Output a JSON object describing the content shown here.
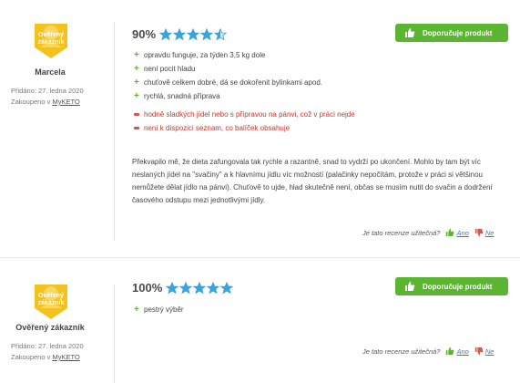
{
  "colors": {
    "green": "#5cb531",
    "red": "#d9534f",
    "star_blue": "#3aa3d8",
    "badge_gold": "#f4c21f"
  },
  "reviews": [
    {
      "badge_text": "Ověřený zákazník",
      "name": "Marcela",
      "date": "Přidáno: 27. ledna 2020",
      "bought_prefix": "Zakoupeno v",
      "bought_shop": "MyKETO",
      "rating_percent": "90%",
      "stars_filled": 4.5,
      "recommend_label": "Doporučuje produkt",
      "pros": [
        "opravdu funguje, za týden 3,5 kg dole",
        "není pocit hladu",
        "chuťově celkem dobré, dá se dokořenit bylinkami apod.",
        "rychlá, snadná příprava"
      ],
      "cons": [
        "hodně sladkých jídel nebo s přípravou na pánvi, což v práci nejde",
        "není k dispozici seznam, co balíček obsahuje"
      ],
      "text": "Překvapilo mě, že dieta zafungovala tak rychle a razantně, snad to vydrží po ukončení. Mohlo by tam být víc neslaných jídel na \"svačiny\" a k hlavnímu jídlu víc možností (palačinky nepočítám, protože v práci si většinou nemůžete dělat jídlo na pánvi). Chuťově to ujde, hlad skutečně není, občas se musím nutit do svačin a dodržení časového odstupu mezi jednotlivými jídly.",
      "helpful_question": "Je tato recenze užitečná?",
      "yes_label": "Ano",
      "no_label": "Ne"
    },
    {
      "badge_text": "Ověřený zákazník",
      "name": "Ověřený zákazník",
      "date": "Přidáno: 27. ledna 2020",
      "bought_prefix": "Zakoupeno v",
      "bought_shop": "MyKETO",
      "rating_percent": "100%",
      "stars_filled": 5,
      "recommend_label": "Doporučuje produkt",
      "pros": [
        "pestrý výběr"
      ],
      "cons": [],
      "text": "",
      "helpful_question": "Je tato recenze užitečná?",
      "yes_label": "Ano",
      "no_label": "Ne"
    }
  ]
}
